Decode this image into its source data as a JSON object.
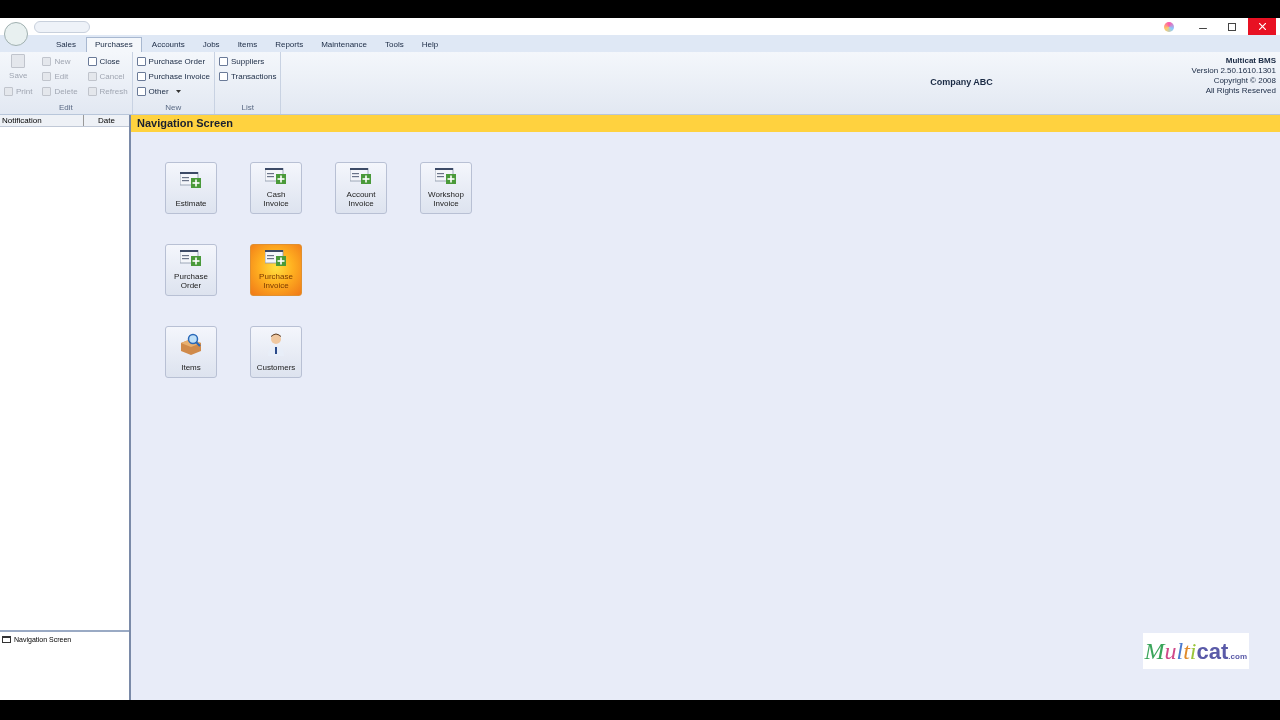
{
  "menu_tabs": [
    {
      "label": "Sales",
      "selected": false
    },
    {
      "label": "Purchases",
      "selected": true
    },
    {
      "label": "Accounts",
      "selected": false
    },
    {
      "label": "Jobs",
      "selected": false
    },
    {
      "label": "Items",
      "selected": false
    },
    {
      "label": "Reports",
      "selected": false
    },
    {
      "label": "Maintenance",
      "selected": false
    },
    {
      "label": "Tools",
      "selected": false
    },
    {
      "label": "Help",
      "selected": false
    }
  ],
  "ribbon_groups": [
    {
      "label": "Edit",
      "columns": [
        [
          {
            "label": "Save",
            "disabled": true,
            "large": true
          },
          {
            "label": "Print",
            "disabled": true
          }
        ],
        [
          {
            "label": "New",
            "disabled": true
          },
          {
            "label": "Edit",
            "disabled": true
          },
          {
            "label": "Delete",
            "disabled": true
          }
        ],
        [
          {
            "label": "Close",
            "disabled": false
          },
          {
            "label": "Cancel",
            "disabled": true
          },
          {
            "label": "Refresh",
            "disabled": true
          }
        ]
      ]
    },
    {
      "label": "New",
      "columns": [
        [
          {
            "label": "Purchase Order",
            "disabled": false
          },
          {
            "label": "Purchase Invoice",
            "disabled": false
          },
          {
            "label": "Other",
            "disabled": false,
            "dropdown": true
          }
        ]
      ]
    },
    {
      "label": "List",
      "columns": [
        [
          {
            "label": "Suppliers",
            "disabled": false
          },
          {
            "label": "Transactions",
            "disabled": false
          }
        ]
      ]
    }
  ],
  "company": "Company ABC",
  "about": [
    "Multicat BMS",
    "Version 2.50.1610.1301",
    "Copyright © 2008",
    "All Rights Reserved"
  ],
  "notification_columns": [
    "Notification",
    "Date"
  ],
  "open_windows": [
    "Navigation Screen"
  ],
  "screen_title": "Navigation Screen",
  "tiles": [
    [
      {
        "label": "Estimate",
        "kind": "form",
        "selected": false
      },
      {
        "label": "Cash Invoice",
        "kind": "form",
        "selected": false
      },
      {
        "label": "Account Invoice",
        "kind": "form",
        "selected": false
      },
      {
        "label": "Workshop Invoice",
        "kind": "form",
        "selected": false
      }
    ],
    [
      {
        "label": "Purchase Order",
        "kind": "form",
        "selected": false
      },
      {
        "label": "Purchase Invoice",
        "kind": "form",
        "selected": true
      }
    ],
    [
      {
        "label": "Items",
        "kind": "items",
        "selected": false
      },
      {
        "label": "Customers",
        "kind": "person",
        "selected": false
      }
    ]
  ],
  "logo": [
    {
      "text": "M",
      "color": "#3aa55a"
    },
    {
      "text": "u",
      "color": "#d04a8a"
    },
    {
      "text": "l",
      "color": "#4a7ad0"
    },
    {
      "text": "t",
      "color": "#e08a2a"
    },
    {
      "text": "i",
      "color": "#9ac53a"
    },
    {
      "text": "cat",
      "color": "#5a5aa8"
    },
    {
      "text": ".com",
      "color": "#5a5aa8"
    }
  ]
}
